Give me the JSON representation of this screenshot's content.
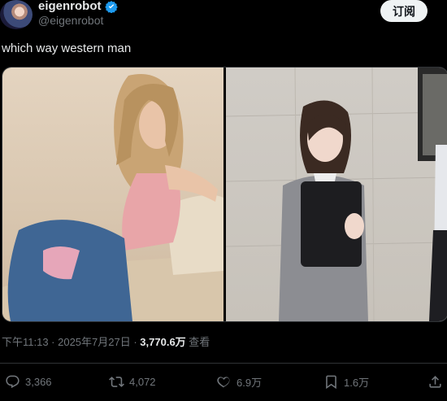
{
  "tweet": {
    "author_name": "eigenrobot",
    "author_handle": "@eigenrobot",
    "subscribe_label": "订阅",
    "text": "which way western man",
    "timestamp": "下午11:13 · 2025年7月27日 · ",
    "views_count": "3,770.6万",
    "views_label": " 查看"
  },
  "actions": {
    "replies": "3,366",
    "reposts": "4,072",
    "likes": "6.9万",
    "bookmarks": "1.6万"
  },
  "colors": {
    "background": "#000000",
    "text": "#e7e9ea",
    "muted": "#71767b",
    "verified": "#1d9bf0"
  }
}
